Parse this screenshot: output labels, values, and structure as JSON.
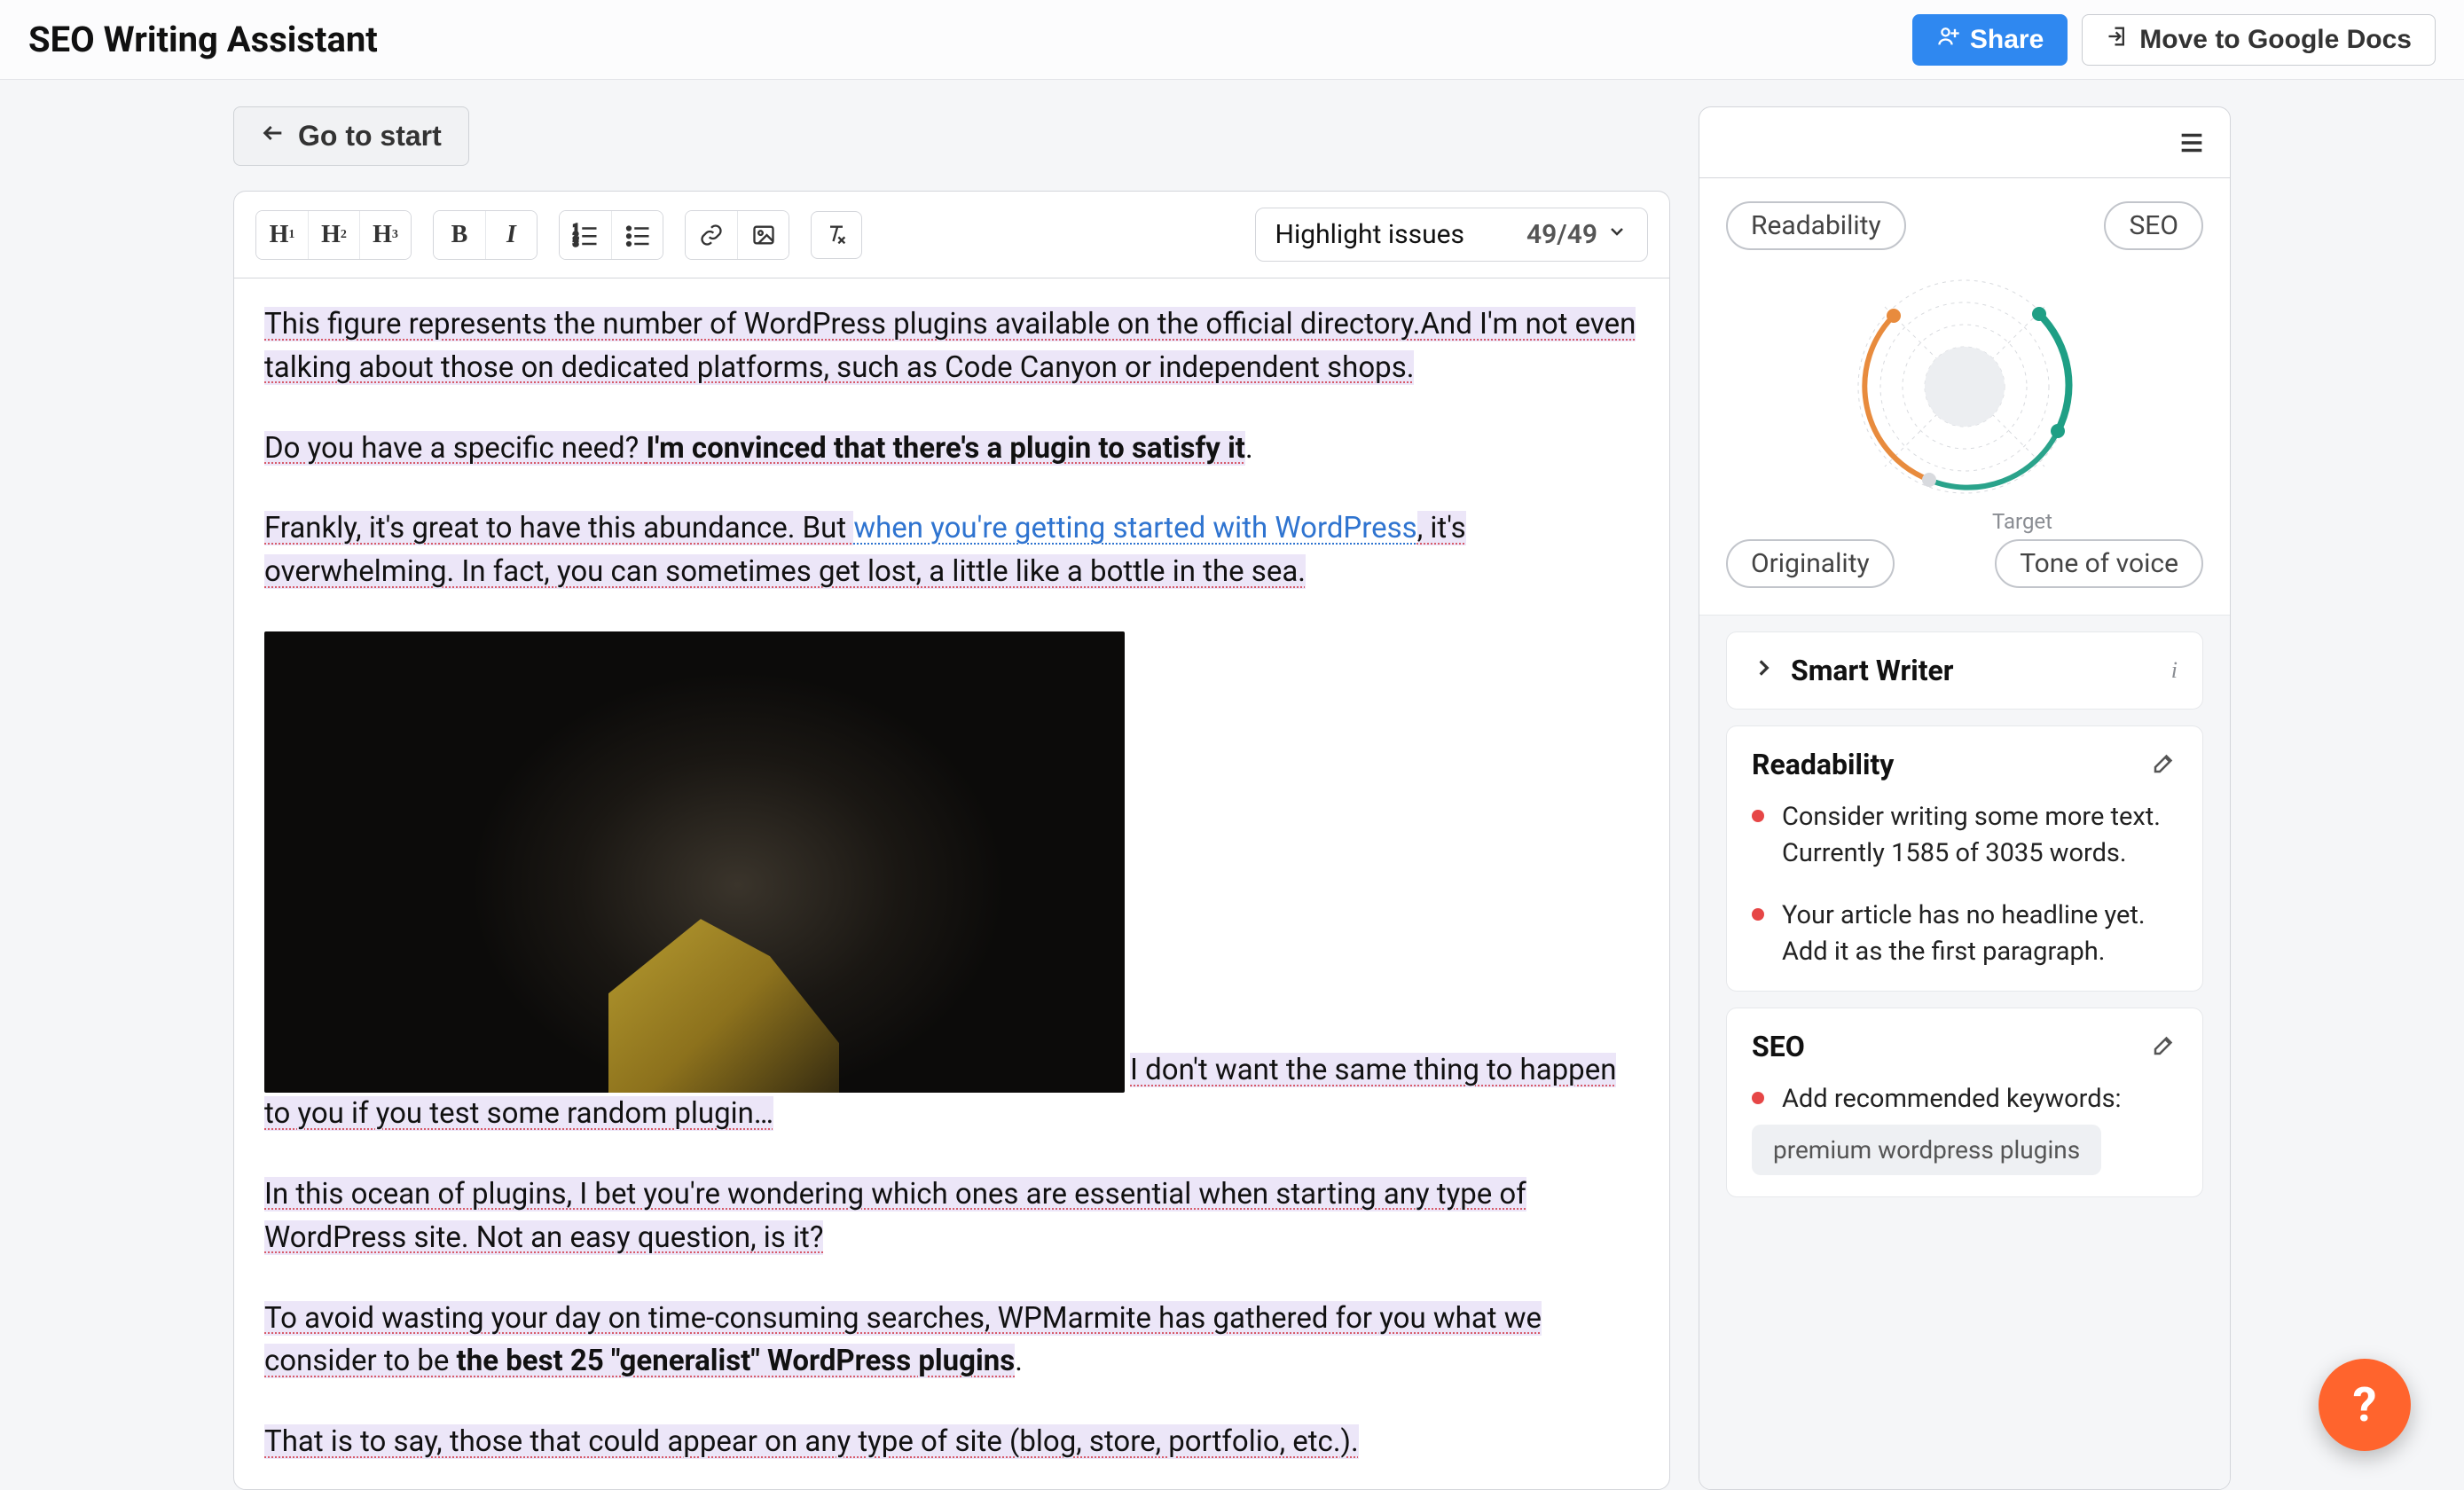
{
  "header": {
    "title": "SEO Writing Assistant",
    "share_label": "Share",
    "move_label": "Move to Google Docs",
    "go_start_label": "Go to start"
  },
  "toolbar": {
    "h1": "H",
    "h1_sub": "1",
    "h2": "H",
    "h2_sub": "2",
    "h3": "H",
    "h3_sub": "3",
    "bold": "B",
    "italic": "I",
    "highlight_label": "Highlight issues",
    "count": "49/49"
  },
  "editor": {
    "p1_a": "This figure represents the number of WordPress plugins available on the official directory.",
    "p1_b": "And I'm not even talking about those on dedicated platforms, such as Code Canyon or independent shops.",
    "p2_a": "Do you have a specific need? ",
    "p2_b": "I'm convinced that there's a plugin to satisfy it",
    "p2_c": ".",
    "p3_a": "Frankly, it's great to have this abundance. But ",
    "p3_link": "when you're getting started with WordPress",
    "p3_b": ", it's overwhelming. In fact, you can sometimes get lost, a little like a bottle in the sea.",
    "p4_a": "I don't want the same thing to happen to you if you test some random plugin…",
    "p5": "In this ocean of plugins, I bet you're wondering which ones are essential when starting any type of WordPress site. Not an easy question, is it?",
    "p6_a": "To avoid wasting your day on time-consuming searches, WPMarmite has gathered for you what we consider to be ",
    "p6_b": "the best 25 \"generalist\" WordPress plugins",
    "p6_c": ".",
    "p7": "That is to say, those that could appear on any type of site (blog, store, portfolio, etc.)."
  },
  "sidebar": {
    "pills": {
      "readability": "Readability",
      "seo": "SEO",
      "originality": "Originality",
      "tone": "Tone of voice"
    },
    "target_label": "Target",
    "smart_writer": "Smart Writer",
    "readability": {
      "title": "Readability",
      "items": [
        "Consider writing some more text. Currently 1585 of 3035 words.",
        "Your article has no headline yet. Add it as the first paragraph."
      ]
    },
    "seo": {
      "title": "SEO",
      "items": [
        "Add recommended keywords:"
      ],
      "keyword_chip": "premium wordpress plugins"
    }
  },
  "fab": "?"
}
